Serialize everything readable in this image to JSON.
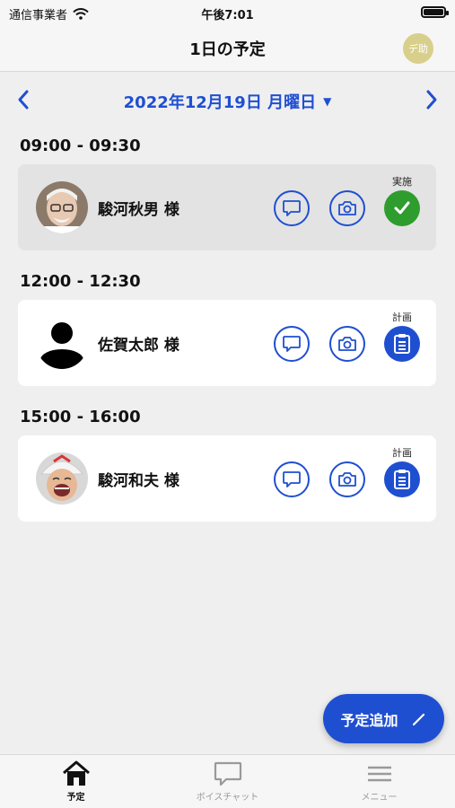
{
  "status_bar": {
    "carrier": "通信事業者",
    "time": "午後7:01"
  },
  "header": {
    "title": "1日の予定",
    "user_badge": "デ助"
  },
  "date_nav": {
    "date": "2022年12月19日 月曜日"
  },
  "slots": [
    {
      "time": "09:00 - 09:30",
      "name": "駿河秋男 様",
      "status": "実施",
      "status_type": "done"
    },
    {
      "time": "12:00 - 12:30",
      "name": "佐賀太郎 様",
      "status": "計画",
      "status_type": "plan"
    },
    {
      "time": "15:00 - 16:00",
      "name": "駿河和夫 様",
      "status": "計画",
      "status_type": "plan"
    }
  ],
  "fab": {
    "label": "予定追加"
  },
  "tabs": [
    {
      "label": "予定"
    },
    {
      "label": "ボイスチャット"
    },
    {
      "label": "メニュー"
    }
  ],
  "colors": {
    "accent": "#1f4fd1",
    "done": "#2e9d2e",
    "badge": "#d9cf8c"
  }
}
